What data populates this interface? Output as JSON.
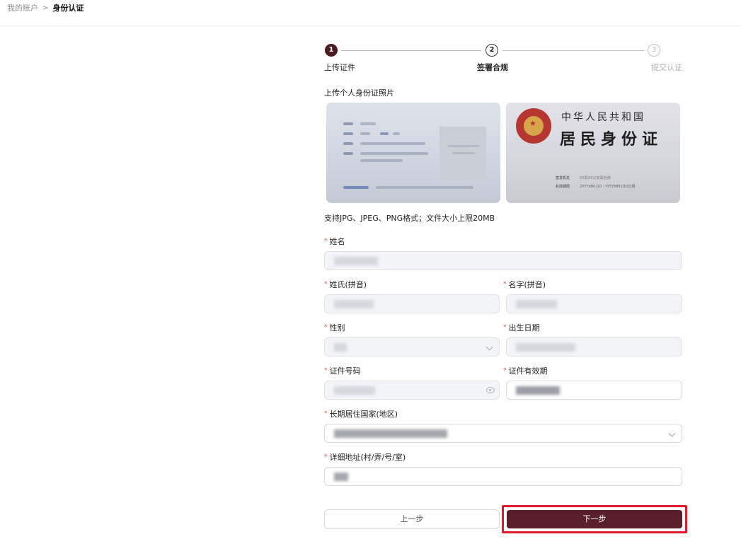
{
  "breadcrumb": {
    "parent": "我的账户",
    "separator": ">",
    "current": "身份认证"
  },
  "steps": [
    {
      "number": "1",
      "label": "上传证件",
      "state": "done"
    },
    {
      "number": "2",
      "label": "签署合规",
      "state": "active"
    },
    {
      "number": "3",
      "label": "提交认证",
      "state": "pending"
    }
  ],
  "upload": {
    "title": "上传个人身份证照片",
    "front_card": {
      "labels": [
        "姓名",
        "性别",
        "民族",
        "出生",
        "住址",
        "公民身份号码"
      ]
    },
    "back_card": {
      "title_line1": "中华人民共和国",
      "title_line2": "居民身份证",
      "authority_label": "签发机关",
      "authority_value": "XX县XX公安局名称",
      "validity_label": "有效期限",
      "validity_value": "20YY.MM.DD - YYYY.MM.DD/长期"
    },
    "format_note": "支持JPG、JPEG、PNG格式；文件大小上限20MB"
  },
  "form": {
    "name": {
      "label": "姓名",
      "value": ""
    },
    "surname_pinyin": {
      "label": "姓氏(拼音)",
      "value": ""
    },
    "given_pinyin": {
      "label": "名字(拼音)",
      "value": ""
    },
    "gender": {
      "label": "性别",
      "value": ""
    },
    "birth_date": {
      "label": "出生日期",
      "value": ""
    },
    "id_number": {
      "label": "证件号码",
      "value": ""
    },
    "id_validity": {
      "label": "证件有效期",
      "value": ""
    },
    "residence_country": {
      "label": "长期居住国家(地区)",
      "value": ""
    },
    "address": {
      "label": "详细地址(村/弄/号/室)",
      "value": ""
    },
    "required_mark": "*"
  },
  "buttons": {
    "prev": "上一步",
    "next": "下一步"
  },
  "colors": {
    "brand": "#5a1f2c",
    "step_active": "#4a1a22",
    "highlight": "#e01a2b",
    "required": "#e35050"
  }
}
